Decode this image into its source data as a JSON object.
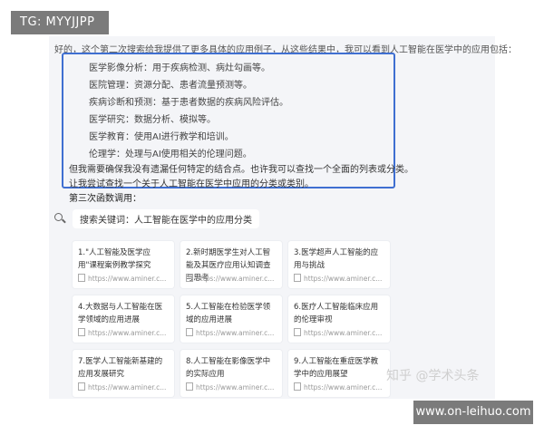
{
  "badge": "TG: MYYJJPP",
  "intro": "好的，这个第二次搜索给我提供了更多具体的应用例子，从这些结果中，我可以看到人工智能在医学中的应用包括：",
  "items": [
    "医学影像分析：用于疾病检测、病灶勾画等。",
    "医院管理：资源分配、患者流量预测等。",
    "疾病诊断和预测：基于患者数据的疾病风险评估。",
    "医学研究：数据分析、模拟等。",
    "医学教育：使用AI进行教学和培训。",
    "伦理学：处理与AI使用相关的伦理问题。"
  ],
  "para1": "但我需要确保我没有遗漏任何特定的结合点。也许我可以查找一个全面的列表或分类。",
  "para2": "让我尝试查找一个关于人工智能在医学中应用的分类或类别。",
  "section_title": "第三次函数调用：",
  "search": {
    "label": "搜索关键词：人工智能在医学中的应用分类",
    "icon": "search-icon"
  },
  "cards": [
    {
      "title": "1.\"人工智能及医学应用\"课程案例教学探究",
      "url": "https://www.aminer.c..."
    },
    {
      "title": "2.新时期医学生对人工智能及其医疗应用认知调查与思考",
      "url": "https://www.aminer.c..."
    },
    {
      "title": "3.医学超声人工智能的应用与挑战",
      "url": "https://www.aminer.c..."
    },
    {
      "title": "4.大数据与人工智能在医学领域的应用进展",
      "url": "https://www.aminer.c..."
    },
    {
      "title": "5.人工智能在检验医学领域的应用进展",
      "url": "https://www.aminer.c..."
    },
    {
      "title": "6.医疗人工智能临床应用的伦理审视",
      "url": "https://www.aminer.c..."
    },
    {
      "title": "7.医学人工智能新基建的应用发展研究",
      "url": "https://www.aminer.c..."
    },
    {
      "title": "8.人工智能在影像医学中的实际应用",
      "url": "https://www.aminer.c..."
    },
    {
      "title": "9.人工智能在重症医学教学中的应用展望",
      "url": "https://www.aminer.c..."
    }
  ],
  "watermark": "知乎 @学术头条",
  "site": "www.on-leihuo.com",
  "colors": {
    "highlight": "#3f6fd1",
    "badge_bg": "#7b7b7b",
    "panel_bg": "#f4f5f8"
  }
}
